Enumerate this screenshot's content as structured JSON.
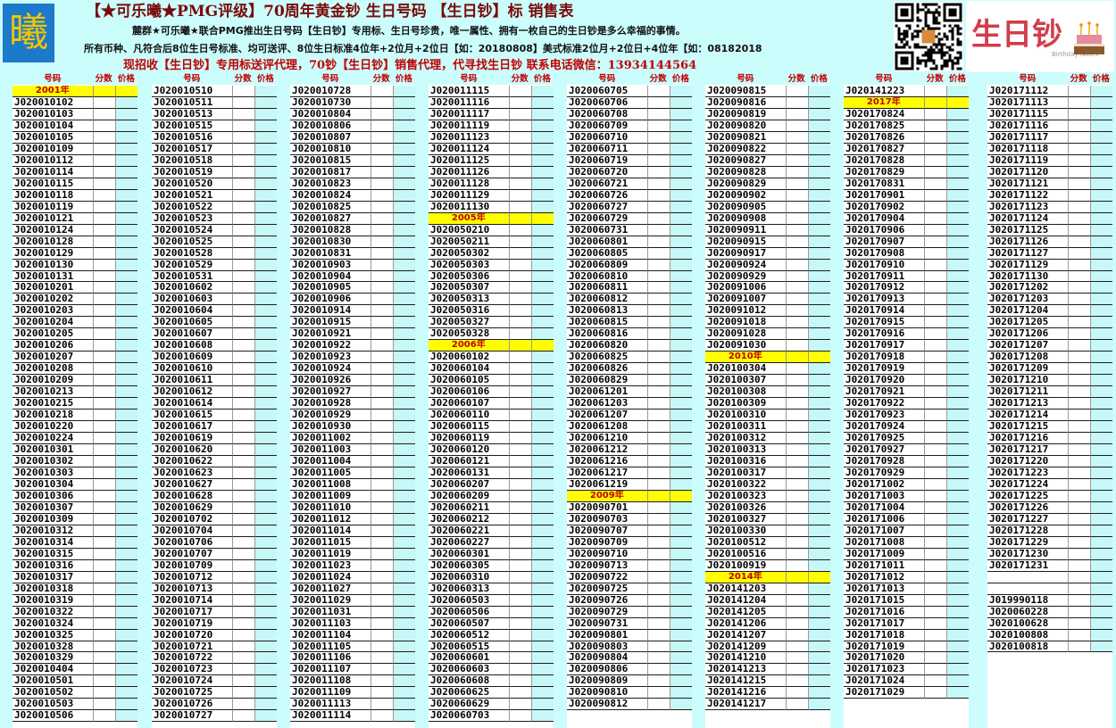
{
  "header": {
    "logo_glyph": "曦",
    "title": "【★可乐曦★PMG评级】70周年黄金钞 生日号码 【生日钞】标 销售表",
    "line1": "麓群★可乐曦★联合PMG推出生日号码【生日钞】专用标、生日号珍贵，唯一属性、拥有一枚自己的生日钞是多么幸福的事情。",
    "line2": "所有币种、凡符合后8位生日号标准、均可送评、8位生日标准4位年+2位月+2位日【如：20180808】美式标准2位月+2位日+4位年【如：08182018",
    "line3": "现招收【生日钞】专用标送评代理，70钞【生日钞】销售代理，代寻找生日钞 联系电话微信：13934144564",
    "bday_logo_text": "生日钞",
    "bday_logo_sub": "Birthday Notes"
  },
  "table_header": {
    "number": "号码",
    "score": "分数",
    "price": "价格"
  },
  "columns": [
    {
      "rows": [
        {
          "year": "2001年"
        },
        "J020010102",
        "J020010103",
        "J020010104",
        "J020010105",
        "J020010109",
        "J020010112",
        "J020010114",
        "J020010115",
        "J020010118",
        "J020010119",
        "J020010121",
        "J020010124",
        "J020010128",
        "J020010129",
        "J020010130",
        "J020010131",
        "J020010201",
        "J020010202",
        "J020010203",
        "J020010204",
        "J020010205",
        "J020010206",
        "J020010207",
        "J020010208",
        "J020010209",
        "J020010213",
        "J020010215",
        "J020010218",
        "J020010220",
        "J020010224",
        "J020010301",
        "J020010302",
        "J020010303",
        "J020010304",
        "J020010306",
        "J020010307",
        "J020010309",
        "J020010312",
        "J020010314",
        "J020010315",
        "J020010316",
        "J020010317",
        "J020010318",
        "J020010319",
        "J020010322",
        "J020010324",
        "J020010325",
        "J020010328",
        "J020010329",
        "J020010404",
        "J020010501",
        "J020010502",
        "J020010503",
        "J020010506"
      ]
    },
    {
      "rows": [
        "J020010510",
        "J020010511",
        "J020010513",
        "J020010515",
        "J020010516",
        "J020010517",
        "J020010518",
        "J020010519",
        "J020010520",
        "J020010521",
        "J020010522",
        "J020010523",
        "J020010524",
        "J020010525",
        "J020010528",
        "J020010529",
        "J020010531",
        "J020010602",
        "J020010603",
        "J020010604",
        "J020010605",
        "J020010607",
        "J020010608",
        "J020010609",
        "J020010610",
        "J020010611",
        "J020010612",
        "J020010614",
        "J020010615",
        "J020010617",
        "J020010619",
        "J020010620",
        "J020010622",
        "J020010623",
        "J020010627",
        "J020010628",
        "J020010629",
        "J020010702",
        "J020010704",
        "J020010706",
        "J020010707",
        "J020010709",
        "J020010712",
        "J020010713",
        "J020010714",
        "J020010717",
        "J020010719",
        "J020010720",
        "J020010721",
        "J020010722",
        "J020010723",
        "J020010724",
        "J020010725",
        "J020010726",
        "J020010727"
      ]
    },
    {
      "rows": [
        "J020010728",
        "J020010730",
        "J020010804",
        "J020010806",
        "J020010807",
        "J020010810",
        "J020010815",
        "J020010817",
        "J020010823",
        "J020010824",
        "J020010825",
        "J020010827",
        "J020010828",
        "J020010830",
        "J020010831",
        "J020010903",
        "J020010904",
        "J020010905",
        "J020010906",
        "J020010914",
        "J020010915",
        "J020010921",
        "J020010922",
        "J020010923",
        "J020010924",
        "J020010926",
        "J020010927",
        "J020010928",
        "J020010929",
        "J020010930",
        "J020011002",
        "J020011003",
        "J020011004",
        "J020011005",
        "J020011008",
        "J020011009",
        "J020011010",
        "J020011012",
        "J020011014",
        "J020011015",
        "J020011019",
        "J020011023",
        "J020011024",
        "J020011027",
        "J020011029",
        "J020011031",
        "J020011103",
        "J020011104",
        "J020011105",
        "J020011106",
        "J020011107",
        "J020011108",
        "J020011109",
        "J020011113",
        "J020011114"
      ]
    },
    {
      "rows": [
        "J020011115",
        "J020011116",
        "J020011117",
        "J020011119",
        "J020011123",
        "J020011124",
        "J020011125",
        "J020011126",
        "J020011128",
        "J020011129",
        "J020011130",
        {
          "year": "2005年"
        },
        "J020050210",
        "J020050211",
        "J020050302",
        "J020050303",
        "J020050306",
        "J020050307",
        "J020050313",
        "J020050316",
        "J020050327",
        "J020050328",
        {
          "year": "2006年"
        },
        "J020060102",
        "J020060104",
        "J020060105",
        "J020060106",
        "J020060107",
        "J020060110",
        "J020060115",
        "J020060119",
        "J020060120",
        "J020060121",
        "J020060131",
        "J020060207",
        "J020060209",
        "J020060211",
        "J020060212",
        "J020060221",
        "J020060227",
        "J020060301",
        "J020060305",
        "J020060310",
        "J020060313",
        "J020060503",
        "J020060506",
        "J020060507",
        "J020060512",
        "J020060515",
        "J020060601",
        "J020060603",
        "J020060608",
        "J020060625",
        "J020060629",
        "J020060703"
      ]
    },
    {
      "rows": [
        "J020060705",
        "J020060706",
        "J020060708",
        "J020060709",
        "J020060710",
        "J020060711",
        "J020060719",
        "J020060720",
        "J020060721",
        "J020060726",
        "J020060727",
        "J020060729",
        "J020060731",
        "J020060801",
        "J020060805",
        "J020060809",
        "J020060810",
        "J020060811",
        "J020060812",
        "J020060813",
        "J020060815",
        "J020060816",
        "J020060820",
        "J020060825",
        "J020060826",
        "J020060829",
        "J020061201",
        "J020061203",
        "J020061207",
        "J020061208",
        "J020061210",
        "J020061212",
        "J020061216",
        "J020061217",
        "J020061219",
        {
          "year": "2009年"
        },
        "J020090701",
        "J020090703",
        "J020090707",
        "J020090709",
        "J020090710",
        "J020090713",
        "J020090722",
        "J020090725",
        "J020090726",
        "J020090729",
        "J020090731",
        "J020090801",
        "J020090803",
        "J020090804",
        "J020090806",
        "J020090809",
        "J020090810",
        "J020090812"
      ]
    },
    {
      "rows": [
        "J020090815",
        "J020090816",
        "J020090819",
        "J020090820",
        "J020090821",
        "J020090822",
        "J020090827",
        "J020090828",
        "J020090829",
        "J020090902",
        "J020090905",
        "J020090908",
        "J020090911",
        "J020090915",
        "J020090917",
        "J020090924",
        "J020090929",
        "J020091006",
        "J020091007",
        "J020091012",
        "J020091018",
        "J020091028",
        "J020091030",
        {
          "year": "2010年"
        },
        "J020100304",
        "J020100307",
        "J020100308",
        "J020100309",
        "J020100310",
        "J020100311",
        "J020100312",
        "J020100313",
        "J020100316",
        "J020100317",
        "J020100322",
        "J020100323",
        "J020100326",
        "J020100327",
        "J020100330",
        "J020100512",
        "J020100516",
        "J020100919",
        {
          "year": "2014年"
        },
        "J020141203",
        "J020141204",
        "J020141205",
        "J020141206",
        "J020141207",
        "J020141209",
        "J020141210",
        "J020141213",
        "J020141215",
        "J020141216",
        "J020141217"
      ]
    },
    {
      "rows": [
        "J020141223",
        {
          "year": "2017年"
        },
        "J020170824",
        "J020170825",
        "J020170826",
        "J020170827",
        "J020170828",
        "J020170829",
        "J020170831",
        "J020170901",
        "J020170902",
        "J020170904",
        "J020170906",
        "J020170907",
        "J020170908",
        "J020170910",
        "J020170911",
        "J020170912",
        "J020170913",
        "J020170914",
        "J020170915",
        "J020170916",
        "J020170917",
        "J020170918",
        "J020170919",
        "J020170920",
        "J020170921",
        "J020170922",
        "J020170923",
        "J020170924",
        "J020170925",
        "J020170927",
        "J020170928",
        "J020170929",
        "J020171002",
        "J020171003",
        "J020171004",
        "J020171006",
        "J020171007",
        "J020171008",
        "J020171009",
        "J020171011",
        "J020171012",
        "J020171013",
        "J020171015",
        "J020171016",
        "J020171017",
        "J020171018",
        "J020171019",
        "J020171020",
        "J020171023",
        "J020171024",
        "J020171029"
      ]
    },
    {
      "rows": [
        "J020171112",
        "J020171113",
        "J020171115",
        "J020171116",
        "J020171117",
        "J020171118",
        "J020171119",
        "J020171120",
        "J020171121",
        "J020171122",
        "J020171123",
        "J020171124",
        "J020171125",
        "J020171126",
        "J020171127",
        "J020171129",
        "J020171130",
        "J020171202",
        "J020171203",
        "J020171204",
        "J020171205",
        "J020171206",
        "J020171207",
        "J020171208",
        "J020171209",
        "J020171210",
        "J020171211",
        "J020171213",
        "J020171214",
        "J020171215",
        "J020171216",
        "J020171217",
        "J020171220",
        "J020171223",
        "J020171224",
        "J020171225",
        "J020171226",
        "J020171227",
        "J020171228",
        "J020171229",
        "J020171230",
        "J020171231",
        "",
        "",
        "J019990118",
        "J020060228",
        "J020100628",
        "J020100808",
        "J020100818"
      ]
    }
  ],
  "colors": {
    "header_bg": "#ccfdfd",
    "title_color": "#7a0a0a",
    "recruit_color": "#c00000",
    "year_bg": "#fffd00",
    "year_text": "#c00000",
    "price_cell_bg": "#c6f8f8"
  }
}
